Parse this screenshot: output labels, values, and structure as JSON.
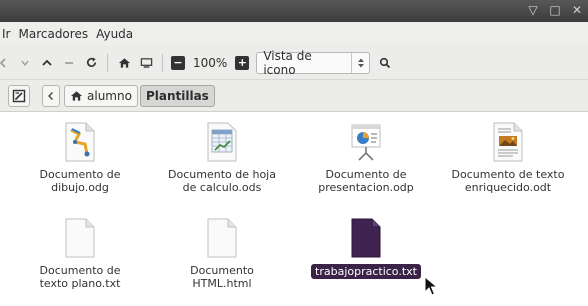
{
  "window": {
    "controls": [
      "▽",
      "□",
      "✕"
    ]
  },
  "menubar": {
    "items": [
      "Ir",
      "Marcadores",
      "Ayuda"
    ]
  },
  "toolbar": {
    "zoom_value": "100%",
    "view_mode": "Vista de icono"
  },
  "location": {
    "crumbs": [
      "alumno",
      "Plantillas"
    ]
  },
  "files": [
    {
      "name": "Documento de dibujo.odg",
      "icon": "drawing-document-icon"
    },
    {
      "name": "Documento de hoja de calculo.ods",
      "icon": "spreadsheet-document-icon"
    },
    {
      "name": "Documento de presentacion.odp",
      "icon": "presentation-document-icon"
    },
    {
      "name": "Documento de texto enriquecido.odt",
      "icon": "richtext-document-icon"
    },
    {
      "name": "Documento de texto plano.txt",
      "icon": "text-document-icon"
    },
    {
      "name": "Documento HTML.html",
      "icon": "html-document-icon"
    },
    {
      "name": "trabajopractico.txt",
      "icon": "text-document-icon",
      "selected": true
    }
  ],
  "colors": {
    "selection": "#3b2347",
    "titlebar": "#4a4a4a",
    "toolbar": "#ececea"
  }
}
